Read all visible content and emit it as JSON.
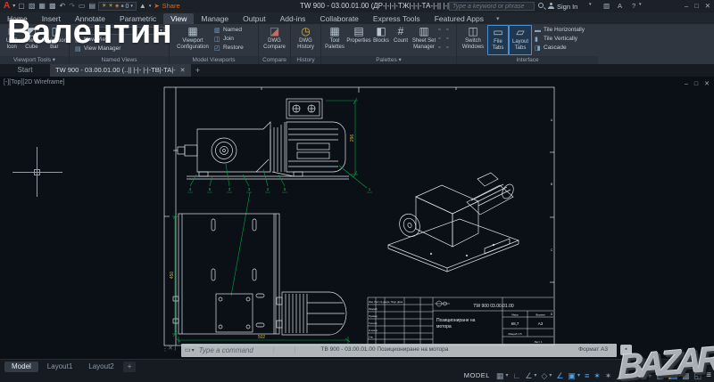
{
  "overlay": {
    "name": "Валентин",
    "logo": "BAZAR"
  },
  "titlebar": {
    "title": "TW 900 - 03.00.01.00 (ДР-|-|-|-ТЖ|-|-|-ТА-|-|| |-|-",
    "search_placeholder": "Type a keyword or phrase",
    "sign_in": "Sign In",
    "layer_value": "0",
    "share": "Share",
    "help": "?"
  },
  "ribbon": {
    "tabs": [
      "Home",
      "Insert",
      "Annotate",
      "Parametric",
      "View",
      "Manage",
      "Output",
      "Add-ins",
      "Collaborate",
      "Express Tools",
      "Featured Apps"
    ],
    "panels": {
      "viewport_tools": {
        "label": "Viewport Tools",
        "ucs": "UCS Icon",
        "cube": "View Cube",
        "navbar": "Navigation Bar"
      },
      "named_views": {
        "label": "Named Views",
        "new_view": "New View",
        "view_manager": "View Manager"
      },
      "model_viewports": {
        "label": "Model Viewports",
        "config": "Viewport Configuration",
        "named": "Named",
        "join": "Join",
        "restore": "Restore"
      },
      "compare": {
        "label": "Compare",
        "dwg_compare": "DWG Compare"
      },
      "history": {
        "label": "History",
        "dwg_history": "DWG History"
      },
      "palettes": {
        "label": "Palettes",
        "tool": "Tool Palettes",
        "properties": "Properties",
        "blocks": "Blocks",
        "count": "Count",
        "ssm": "Sheet Set Manager"
      },
      "interface": {
        "label": "Interface",
        "switch": "Switch Windows",
        "file_tabs": "File Tabs",
        "layout_tabs": "Layout Tabs",
        "tile_h": "Tile Horizontally",
        "tile_v": "Tile Vertically",
        "cascade": "Cascade"
      }
    }
  },
  "filetabs": {
    "start": "Start",
    "doc": "TW 900 - 03.00.01.00 (..|| |-|- |-|-TB|-TA|-"
  },
  "canvas": {
    "viewport_label": "[-][Top][2D Wireframe]"
  },
  "commandbar": {
    "prompt": "Type a command",
    "frame_text": "ТВ 900 - 03.00.01.00   Позициониране на мотора",
    "frame_text_right": "Формат А3"
  },
  "drawing": {
    "zones": [
      "A",
      "B",
      "C",
      "D"
    ],
    "dims": {
      "front_height": "296",
      "plate_height": "450",
      "plate_width": "502"
    },
    "items": [
      "4",
      "5",
      "3",
      "3",
      "2",
      "6",
      "1"
    ],
    "title_block": {
      "doc_no": "TW 900   03.00.01.00",
      "title1": "Позициониране на",
      "title2": "мотора",
      "mass_label": "Маса",
      "mass": "68,7",
      "format_label": "Формат",
      "format": "А3",
      "scale": "Мащаб 1:5",
      "sheet": "Лист 1",
      "rev_header": "Изм. Лист № докум. Подп. Дата",
      "rev_rows": [
        "Разраб.",
        "Провер.",
        "Т.контр.",
        "Н.контр.",
        "Утв."
      ]
    }
  },
  "bottombar": {
    "tabs": [
      "Model",
      "Layout1",
      "Layout2"
    ],
    "model_badge": "MODEL"
  },
  "g": {
    "dd": "▾",
    "min": "–",
    "max": "□",
    "close": "✕",
    "appmark": "A",
    "new": "▢",
    "open": "▧",
    "save": "▦",
    "saveas": "▩",
    "undo": "↶",
    "redo": "↷",
    "plot": "▭",
    "batch": "▤",
    "bulb": "☀",
    "lock": "◈",
    "sq": "■",
    "ws": "▲",
    "share_arrow": "➤",
    "cart": "▥",
    "astore": "A",
    "ucs": "∟",
    "cube": "◩",
    "navbar": "▯",
    "newview": "▣",
    "viewmgr": "▤",
    "vpcfg": "▦",
    "named": "▥",
    "join": "◫",
    "restore": "◰",
    "cmp": "◪",
    "hist": "◷",
    "tool": "▦",
    "props": "▤",
    "blocks": "◧",
    "count": "#",
    "ssm": "▥",
    "sw": "◫",
    "ftabs": "▭",
    "ltabs": "▱",
    "tileh": "▬",
    "tilev": "▮",
    "casc": "◨",
    "mini": "▫",
    "grip": "⋮",
    "wrench": "⟩",
    "cmdicon": "▭",
    "plus": "+",
    "sgrid": "▦",
    "ortho": "∟",
    "polar": "∠",
    "isod": "◇",
    "otrk": "∠",
    "osnap": "▣",
    "lwt": "≡",
    "ann": "✶",
    "scale2": "◢",
    "gear": "⚙",
    "isolate": "▨",
    "img": "▩",
    "clean": "◱",
    "menu": "≡"
  }
}
